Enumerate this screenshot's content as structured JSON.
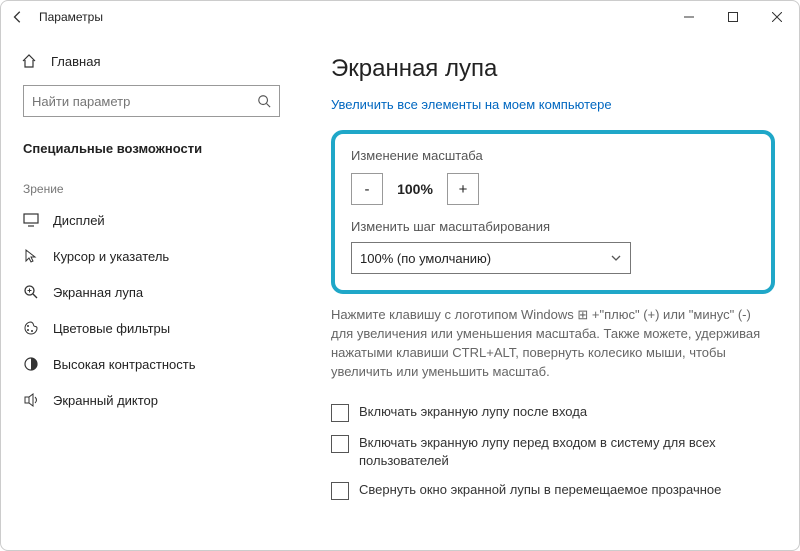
{
  "window": {
    "title": "Параметры"
  },
  "sidebar": {
    "home": "Главная",
    "search_placeholder": "Найти параметр",
    "section": "Специальные возможности",
    "group": "Зрение",
    "items": [
      {
        "label": "Дисплей"
      },
      {
        "label": "Курсор и указатель"
      },
      {
        "label": "Экранная лупа"
      },
      {
        "label": "Цветовые фильтры"
      },
      {
        "label": "Высокая контрастность"
      },
      {
        "label": "Экранный диктор"
      }
    ]
  },
  "page": {
    "title": "Экранная лупа",
    "link": "Увеличить все элементы на моем компьютере",
    "zoom_section": "Изменение масштаба",
    "zoom_value": "100%",
    "step_label": "Изменить шаг масштабирования",
    "step_value": "100% (по умолчанию)",
    "help": "Нажмите клавишу с логотипом Windows ⊞ +\"плюс\" (+) или \"минус\" (-) для увеличения или уменьшения масштаба. Также можете, удерживая нажатыми клавиши CTRL+ALT, повернуть колесико мыши, чтобы увеличить или уменьшить масштаб.",
    "checks": [
      "Включать экранную лупу после входа",
      "Включать экранную лупу перед входом в систему для всех пользователей",
      "Свернуть окно экранной лупы в перемещаемое прозрачное"
    ]
  }
}
